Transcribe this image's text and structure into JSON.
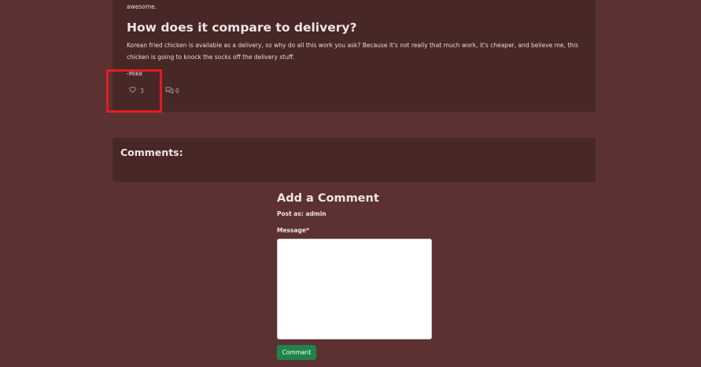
{
  "post": {
    "intro_tail": "awesome.",
    "heading": "How does it compare to delivery?",
    "body": "Korean fried chicken is available as a delivery, so why do all this work you ask? Because it's not really that much work, it's cheaper, and believe me, this chicken is going to knock the socks off the delivery stuff.",
    "signature": "-Mike",
    "likes": "3",
    "comments": "0"
  },
  "comments_section": {
    "title": "Comments:"
  },
  "add_comment": {
    "title": "Add a Comment",
    "post_as": "Post as: admin",
    "message_label": "Message*",
    "submit_label": "Comment"
  },
  "icons": {
    "like": "heart-outline-icon",
    "comment": "speech-bubble-icon"
  },
  "colors": {
    "page_bg": "#5c3131",
    "card_bg": "#482727",
    "highlight": "#e31c24",
    "button": "#1e8449"
  }
}
